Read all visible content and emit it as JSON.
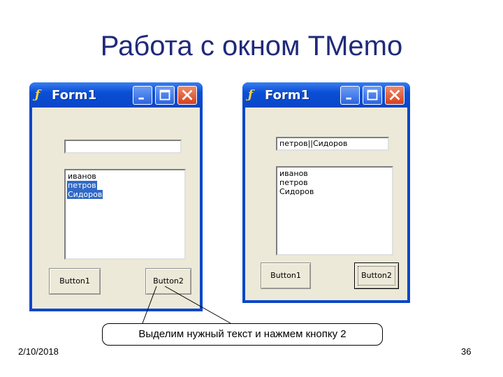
{
  "slide": {
    "title": "Работа с окном TMemo",
    "date": "2/10/2018",
    "page_number": "36"
  },
  "callout": {
    "text": "Выделим нужный текст и нажмем кнопку 2"
  },
  "window_left": {
    "title": "Form1",
    "edit_value": "",
    "memo_lines": [
      {
        "text": "иванов",
        "selected": false
      },
      {
        "text": "петров",
        "selected": true
      },
      {
        "text": "Сидоров",
        "selected": true
      }
    ],
    "button1_label": "Button1",
    "button2_label": "Button2"
  },
  "window_right": {
    "title": "Form1",
    "edit_value": "петров||Сидоров",
    "memo_lines": [
      {
        "text": "иванов",
        "selected": false
      },
      {
        "text": "петров",
        "selected": false
      },
      {
        "text": "Сидоров",
        "selected": false
      }
    ],
    "button1_label": "Button1",
    "button2_label": "Button2"
  },
  "colors": {
    "title_color": "#1f2a7a",
    "window_frame": "#0a47c8",
    "selection": "#316ac5",
    "client": "#ece9d8"
  },
  "icons": {
    "app": "delphi-form-icon",
    "minimize": "minimize-icon",
    "maximize": "maximize-icon",
    "close": "close-icon"
  }
}
